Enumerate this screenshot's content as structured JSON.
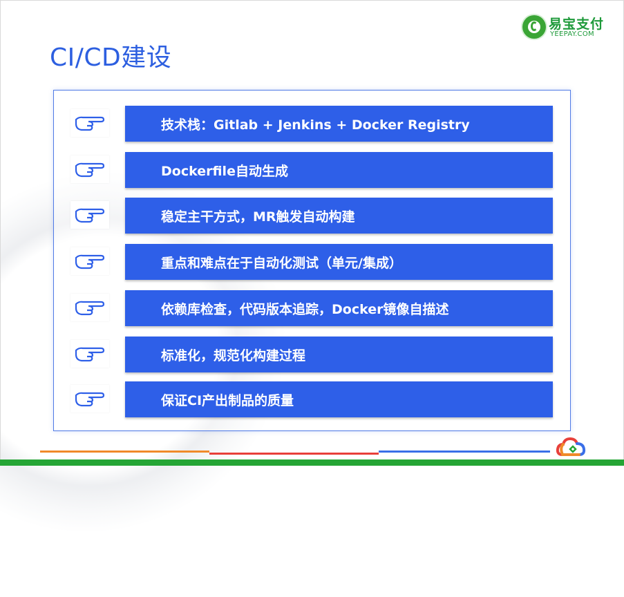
{
  "slide": {
    "title": "CI/CD建设"
  },
  "logo": {
    "name_cn": "易宝支付",
    "name_en": "YEEPAY.COM",
    "brand_color": "#1e9a3a"
  },
  "items": [
    {
      "icon": "pointing-hand-icon",
      "text": "技术栈：Gitlab + Jenkins + Docker Registry"
    },
    {
      "icon": "pointing-hand-icon",
      "text": "Dockerfile自动生成"
    },
    {
      "icon": "pointing-hand-icon",
      "text": "稳定主干方式，MR触发自动构建"
    },
    {
      "icon": "pointing-hand-icon",
      "text": "重点和难点在于自动化测试（单元/集成）"
    },
    {
      "icon": "pointing-hand-icon",
      "text": "依赖库检查，代码版本追踪，Docker镜像自描述"
    },
    {
      "icon": "pointing-hand-icon",
      "text": "标准化，规范化构建过程"
    },
    {
      "icon": "pointing-hand-icon",
      "text": "保证CI产出制品的质量"
    }
  ],
  "colors": {
    "title": "#2d5fe0",
    "bar": "#2e5fe8",
    "footer_orange": "#f08a2a",
    "footer_red": "#e8403a",
    "footer_blue": "#3a6fe8",
    "footer_green": "#25a535"
  }
}
